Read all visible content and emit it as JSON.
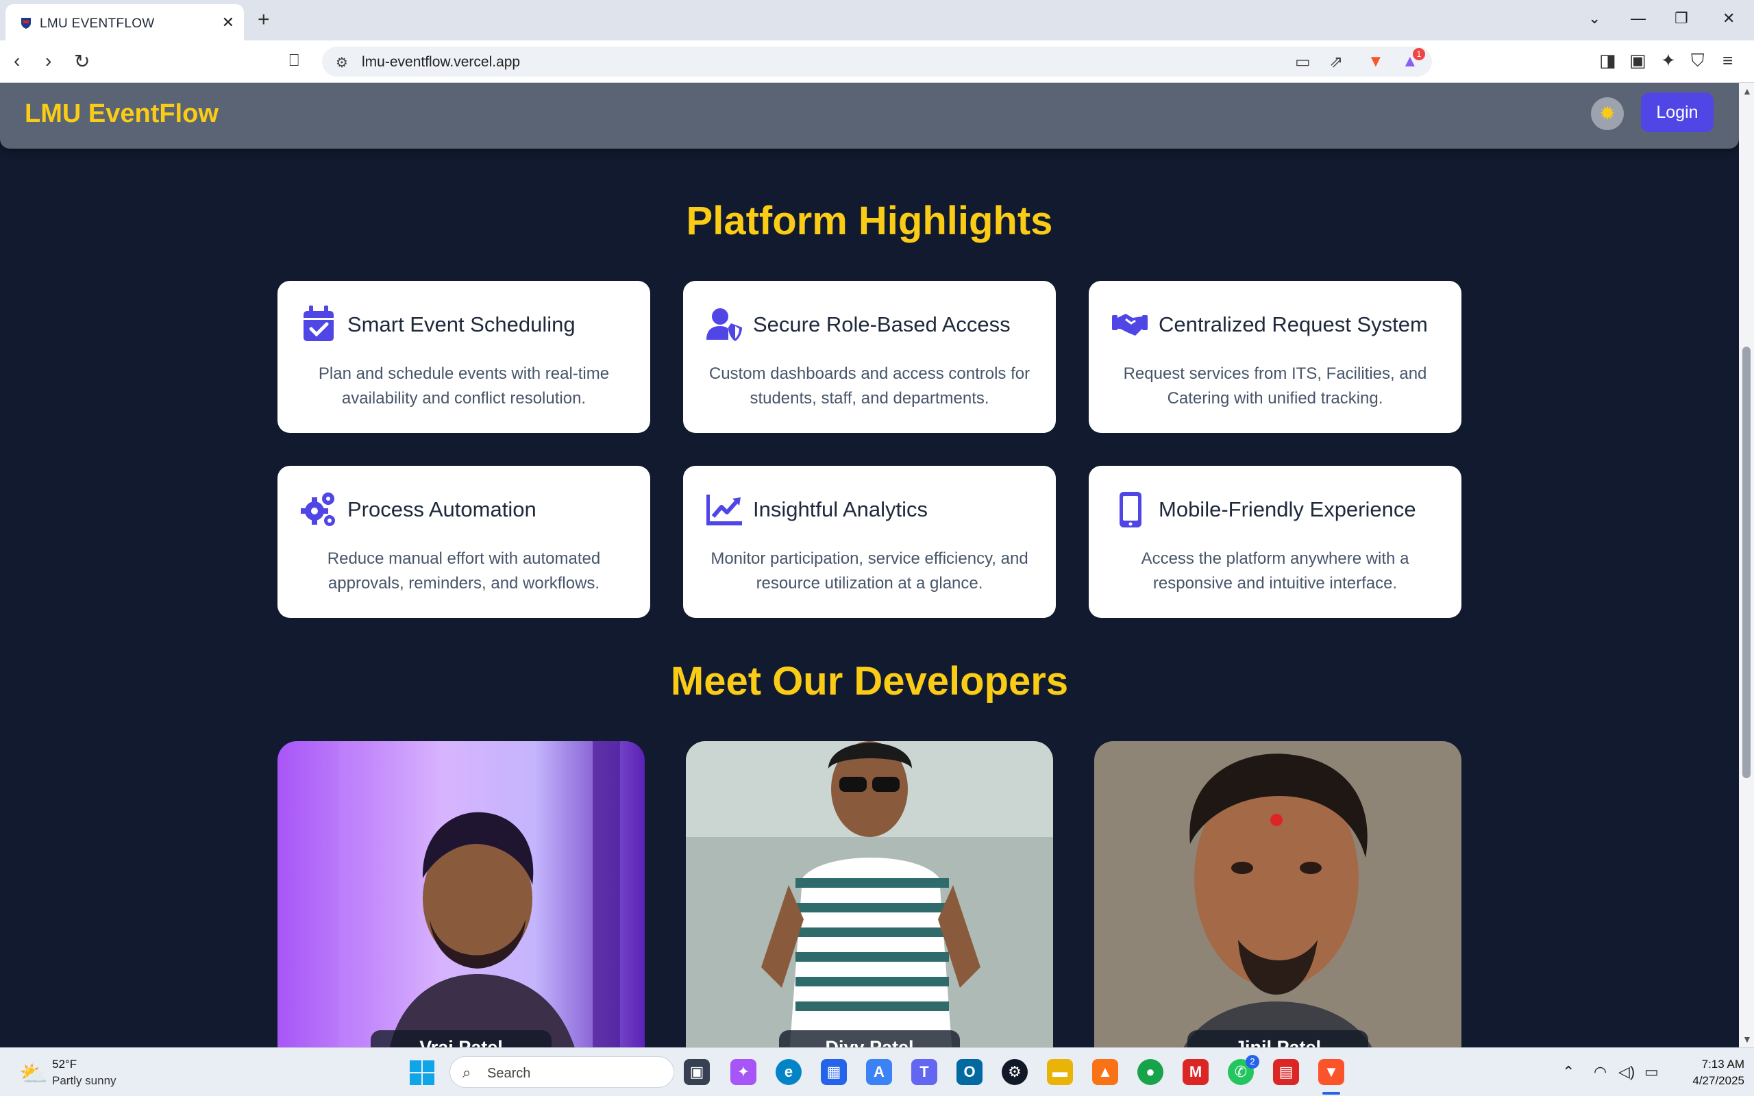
{
  "browser": {
    "tab_title": "LMU EVENTFLOW",
    "url": "lmu-eventflow.vercel.app",
    "notification_count": "1"
  },
  "site": {
    "brand": "LMU EventFlow",
    "login_label": "Login",
    "highlights_title": "Platform Highlights",
    "developers_title": "Meet Our Developers"
  },
  "features": [
    {
      "title": "Smart Event Scheduling",
      "desc": "Plan and schedule events with real-time availability and conflict resolution.",
      "icon": "calendar-check-icon"
    },
    {
      "title": "Secure Role-Based Access",
      "desc": "Custom dashboards and access controls for students, staff, and departments.",
      "icon": "user-shield-icon"
    },
    {
      "title": "Centralized Request System",
      "desc": "Request services from ITS, Facilities, and Catering with unified tracking.",
      "icon": "handshake-icon"
    },
    {
      "title": "Process Automation",
      "desc": "Reduce manual effort with automated approvals, reminders, and workflows.",
      "icon": "gears-icon"
    },
    {
      "title": "Insightful Analytics",
      "desc": "Monitor participation, service efficiency, and resource utilization at a glance.",
      "icon": "chart-line-icon"
    },
    {
      "title": "Mobile-Friendly Experience",
      "desc": "Access the platform anywhere with a responsive and intuitive interface.",
      "icon": "mobile-icon"
    }
  ],
  "developers": [
    {
      "name": "Vraj Patel"
    },
    {
      "name": "Divy Patel"
    },
    {
      "name": "Jinil Patel"
    }
  ],
  "colors": {
    "accent": "#facc15",
    "primary": "#4f46e5",
    "background": "#111a2e",
    "header": "#5b6475"
  },
  "taskbar": {
    "weather_temp": "52°F",
    "weather_desc": "Partly sunny",
    "search_label": "Search",
    "time": "7:13 AM",
    "date": "4/27/2025",
    "whatsapp_badge": "2"
  }
}
